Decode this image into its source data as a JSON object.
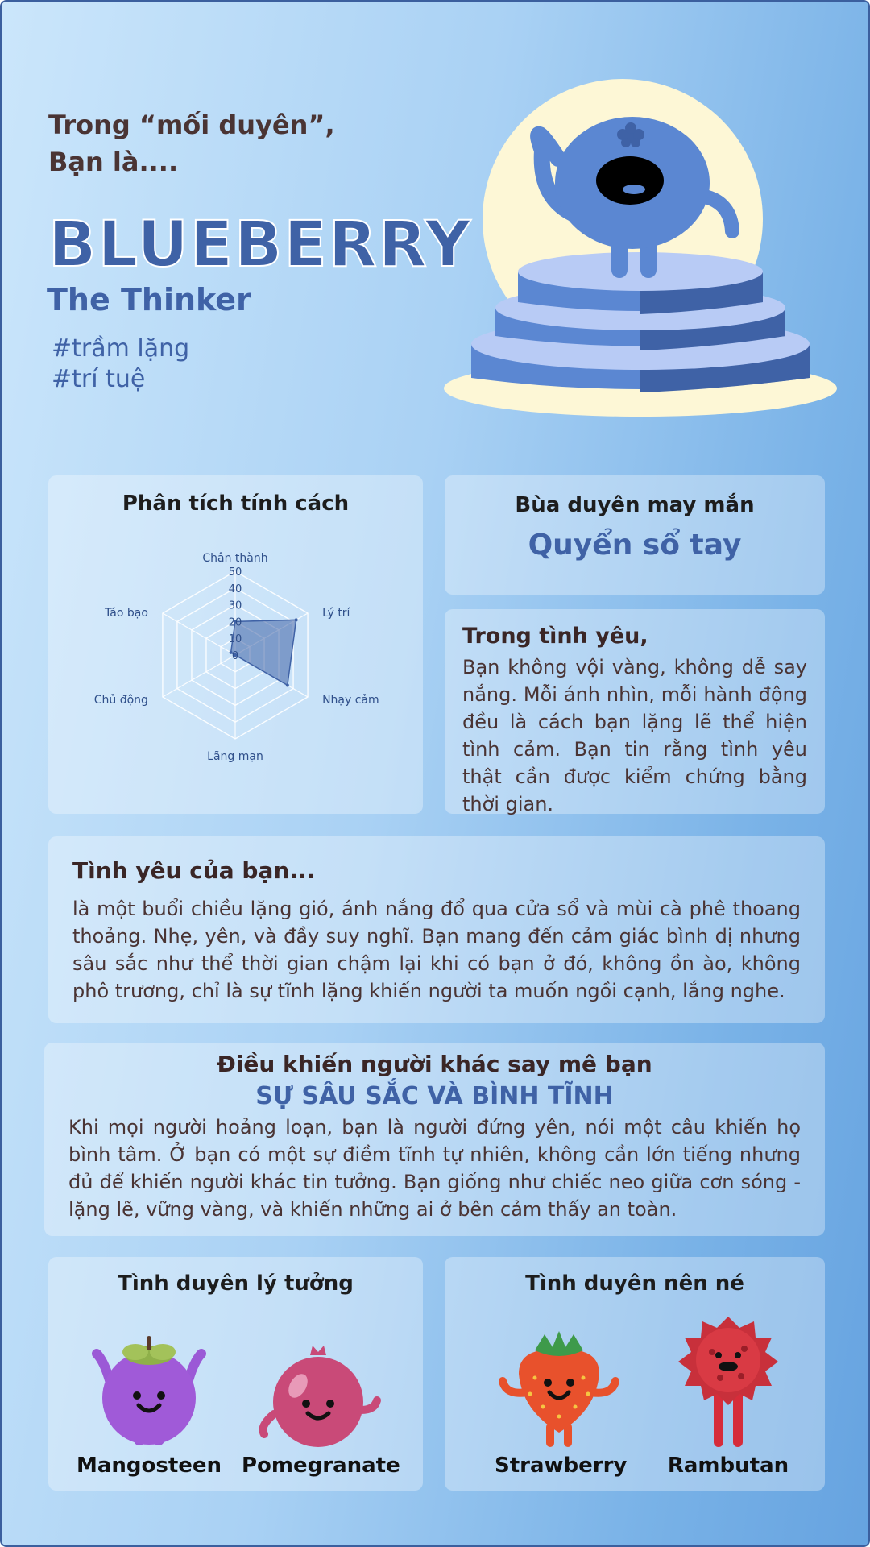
{
  "intro": {
    "line1": "Trong “mối duyên”,",
    "line2": "Bạn là...."
  },
  "result": {
    "name": "BLUEBERRY",
    "subtitle": "The Thinker",
    "tags": [
      "#trầm lặng",
      "#trí tuệ"
    ]
  },
  "radar_card": {
    "title": "Phân tích tính cách"
  },
  "chart_data": {
    "type": "radar",
    "categories": [
      "Chân thành",
      "Lý trí",
      "Nhạy cảm",
      "Lãng mạn",
      "Chủ động",
      "Táo bạo"
    ],
    "values": [
      20,
      42,
      36,
      0,
      0,
      3
    ],
    "rlim": [
      0,
      50
    ],
    "ticks": [
      "0",
      "10",
      "20",
      "30",
      "40",
      "50"
    ],
    "colors": {
      "fill": "#3f62a6",
      "grid": "#ffffff",
      "label": "#2f4f8a"
    }
  },
  "charm_card": {
    "title": "Bùa duyên may mắn",
    "value": "Quyển sổ tay"
  },
  "love_card": {
    "title": "Trong tình yêu,",
    "text": "Bạn không vội vàng, không dễ say nắng. Mỗi ánh nhìn, mỗi hành động đều là cách bạn lặng lẽ thể hiện tình cảm. Bạn tin rằng tình yêu thật cần được kiểm chứng bằng thời gian."
  },
  "your_love": {
    "title": "Tình yêu của bạn...",
    "text": "là một buổi chiều lặng gió, ánh nắng đổ qua cửa sổ và mùi cà phê thoang thoảng. Nhẹ, yên, và đầy suy nghĩ. Bạn mang đến cảm giác bình dị nhưng sâu sắc như thể thời gian chậm lại khi có bạn ở đó, không ồn ào, không phô trương, chỉ là sự tĩnh lặng khiến người ta muốn ngồi cạnh, lắng nghe."
  },
  "attraction": {
    "title": "Điều khiến người khác say mê bạn",
    "highlight": "SỰ SÂU SẮC VÀ BÌNH TĨNH",
    "text": "Khi mọi người hoảng loạn, bạn là người đứng yên, nói một câu khiến họ bình tâm. Ở bạn có một sự điềm tĩnh tự nhiên, không cần lớn tiếng nhưng đủ để khiến người khác tin tưởng. Bạn giống như chiếc neo giữa cơn sóng - lặng lẽ, vững vàng, và khiến những ai ở bên cảm thấy an toàn."
  },
  "ideal_match": {
    "title": "Tình duyên lý tưởng",
    "fruits": [
      "Mangosteen",
      "Pomegranate"
    ]
  },
  "avoid_match": {
    "title": "Tình duyên nên né",
    "fruits": [
      "Strawberry",
      "Rambutan"
    ]
  },
  "colors": {
    "accent": "#3f62a6",
    "text_dark": "#4a3434",
    "spotlight": "#fdf7d6"
  }
}
